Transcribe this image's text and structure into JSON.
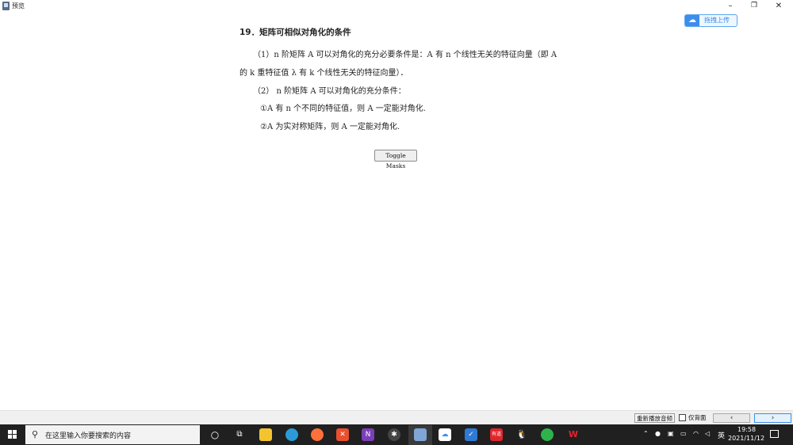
{
  "window": {
    "title": "预览",
    "minimize": "–",
    "maximize": "❐",
    "close": "✕"
  },
  "upload": {
    "label": "拖拽上传",
    "icon": "cloud-icon"
  },
  "content": {
    "heading": "19．矩阵可相似对角化的条件",
    "line1": "（1）n 阶矩阵 A 可以对角化的充分必要条件是：A 有 n 个线性无关的特征向量（即 A",
    "line2": "的 k 重特征值 λ 有 k 个线性无关的特征向量）．",
    "line3": "（2） n 阶矩阵 A 可以对角化的充分条件：",
    "line4": "①A 有 n 个不同的特征值，则 A 一定能对角化.",
    "line5": "②A 为实对称矩阵，则 A 一定能对角化."
  },
  "toggle_button": "Toggle Masks",
  "bottom_bar": {
    "replay_audio": "重新播放音频",
    "background_only": "仅背面",
    "prev": "‹",
    "next": "›"
  },
  "taskbar": {
    "search_placeholder": "在这里输入你要搜索的内容",
    "ime": "英",
    "time": "19:58",
    "date": "2021/11/12",
    "apps": [
      "cortana-icon",
      "task-view-icon",
      "file-explorer-icon",
      "edge-icon",
      "firefox-icon",
      "xmind-icon",
      "onenote-icon",
      "davinci-icon",
      "anki-icon",
      "baidu-netdisk-icon",
      "todo-icon",
      "youdao-icon",
      "qq-icon",
      "wechat-icon",
      "wps-icon"
    ],
    "youdao_label": "有道"
  }
}
